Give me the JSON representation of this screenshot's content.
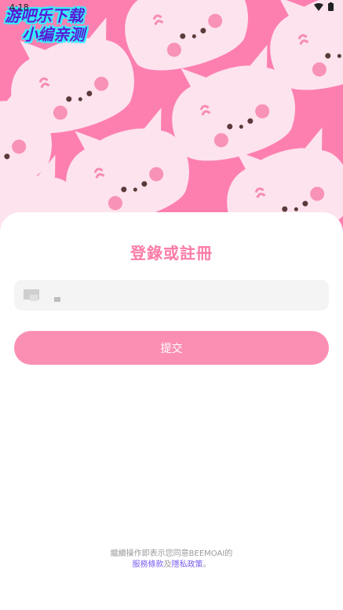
{
  "status_bar": {
    "time": "4:18"
  },
  "watermark": {
    "line1": "游吧乐下载",
    "line2": "小编亲测"
  },
  "login": {
    "title": "登錄或註冊",
    "phone_value": "",
    "submit_label": "提交"
  },
  "terms": {
    "prefix": "繼續操作即表示您同意BEEMOAI的",
    "service_link": "服務條款",
    "connector": "及",
    "privacy_link": "隱私政策",
    "suffix": "。"
  },
  "colors": {
    "hero_pink": "#fd7fb0",
    "cat_pink": "#fde3ee",
    "accent_pink": "#fb7ba7",
    "link_purple": "#7b5cf0"
  }
}
